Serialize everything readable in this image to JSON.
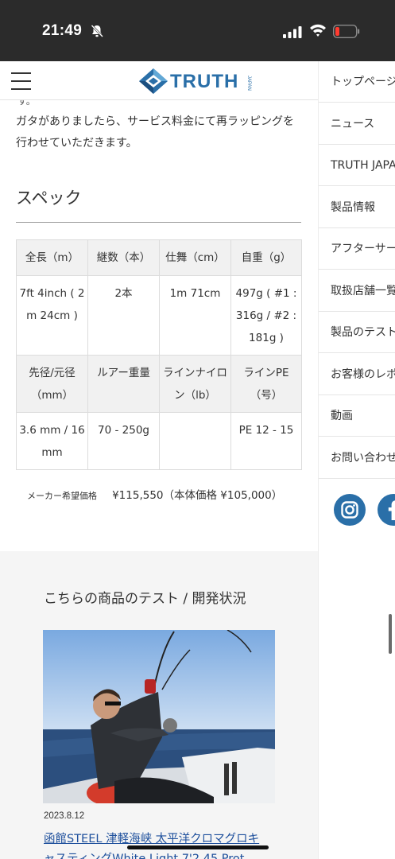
{
  "status_bar": {
    "time": "21:49"
  },
  "header": {
    "logo_text": "TRUTH",
    "logo_sub": "JAPAN"
  },
  "content": {
    "cut_text": "す。",
    "intro": "ガタがありましたら、サービス料金にて再ラッピングを行わせていただきます。",
    "spec_title": "スペック",
    "spec_table": {
      "head1": [
        "全長（m）",
        "継数（本）",
        "仕舞（cm）",
        "自重（g）"
      ],
      "row1": [
        "7ft 4inch ( 2m 24cm )",
        "2本",
        "1m 71cm",
        "497g ( #1 : 316g / #2 : 181g )"
      ],
      "head2": [
        "先径/元径（mm）",
        "ルアー重量",
        "ラインナイロン（lb）",
        "ラインPE（号）"
      ],
      "row2": [
        "3.6 mm / 16 mm",
        "70 - 250g",
        "",
        "PE 12 - 15"
      ]
    },
    "price_label": "メーカー希望価格",
    "price_value": "¥115,550（本体価格 ¥105,000）"
  },
  "test_section": {
    "title": "こちらの商品のテスト / 開発状況",
    "date": "2023.8.12",
    "link": "函館STEEL 津軽海峡 太平洋クロマグロキ",
    "link_line2": "ャスティングWhite Light 7'2 45 Prot"
  },
  "menu": {
    "items": [
      "トップページ",
      "ニュース",
      "TRUTH JAPAN",
      "製品情報",
      "アフターサービス",
      "取扱店舗一覧",
      "製品のテスト",
      "お客様のレポート",
      "動画",
      "お問い合わせ"
    ]
  },
  "colors": {
    "brand": "#2a6fa8",
    "link": "#1d4f9c",
    "instagram": "#2a6fa8",
    "facebook": "#2a6fa8"
  },
  "icons": [
    "hamburger-icon",
    "bell-slash-icon",
    "signal-icon",
    "wifi-icon",
    "battery-low-icon",
    "instagram-icon",
    "facebook-icon"
  ]
}
